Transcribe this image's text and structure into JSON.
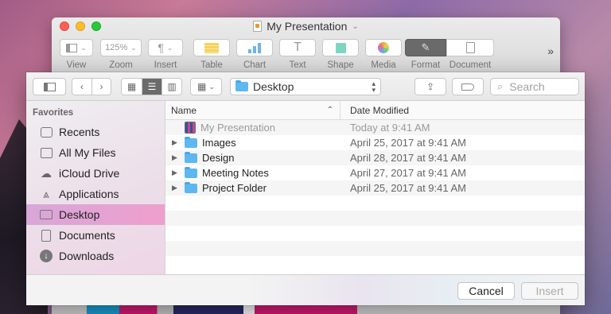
{
  "keynote": {
    "document_title": "My Presentation",
    "toolbar": [
      {
        "label": "View",
        "icon": "view-icon"
      },
      {
        "label": "Zoom",
        "value": "125%"
      },
      {
        "label": "Insert",
        "icon": "paragraph-icon"
      },
      {
        "label": "Table",
        "icon": "table-icon"
      },
      {
        "label": "Chart",
        "icon": "chart-icon"
      },
      {
        "label": "Text",
        "icon": "text-icon"
      },
      {
        "label": "Shape",
        "icon": "shape-icon"
      },
      {
        "label": "Media",
        "icon": "media-icon"
      },
      {
        "label": "Format",
        "icon": "format-brush-icon"
      },
      {
        "label": "Document",
        "icon": "document-icon"
      }
    ],
    "overflow": "»"
  },
  "dialog": {
    "location": "Desktop",
    "search_placeholder": "Search",
    "sidebar": {
      "heading": "Favorites",
      "items": [
        {
          "label": "Recents",
          "icon": "recents-icon"
        },
        {
          "label": "All My Files",
          "icon": "all-files-icon"
        },
        {
          "label": "iCloud Drive",
          "icon": "cloud-icon"
        },
        {
          "label": "Applications",
          "icon": "applications-icon"
        },
        {
          "label": "Desktop",
          "icon": "desktop-icon"
        },
        {
          "label": "Documents",
          "icon": "documents-icon"
        },
        {
          "label": "Downloads",
          "icon": "downloads-icon"
        }
      ]
    },
    "columns": {
      "name": "Name",
      "date": "Date Modified"
    },
    "files": [
      {
        "name": "My Presentation",
        "date": "Today at 9:41 AM"
      },
      {
        "name": "Images",
        "date": "April 25, 2017 at 9:41 AM"
      },
      {
        "name": "Design",
        "date": "April 28, 2017 at 9:41 AM"
      },
      {
        "name": "Meeting Notes",
        "date": "April 27, 2017 at 9:41 AM"
      },
      {
        "name": "Project Folder",
        "date": "April 25, 2017 at 9:41 AM"
      }
    ],
    "buttons": {
      "cancel": "Cancel",
      "insert": "Insert"
    }
  },
  "colors": {
    "selection": "#ee9fcd",
    "folder": "#5fb7f0"
  }
}
